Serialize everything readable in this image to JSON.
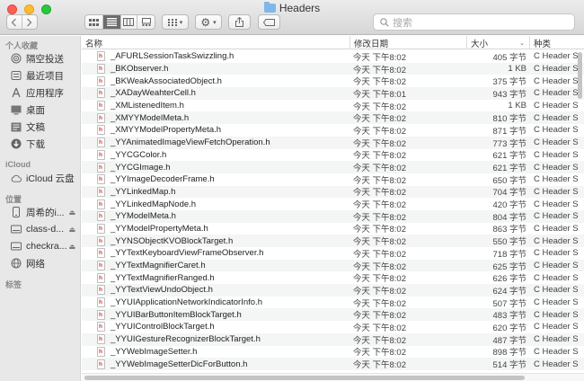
{
  "window": {
    "title": "Headers"
  },
  "toolbar": {
    "back_icon": "chevron-left-icon",
    "forward_icon": "chevron-right-icon",
    "view_icons": [
      "icon-view-icon",
      "list-view-icon",
      "column-view-icon",
      "gallery-view-icon"
    ],
    "group_icon": "group-grid-icon",
    "action_icon": "gear-icon",
    "share_icon": "share-icon",
    "tag_icon": "tag-icon",
    "search_placeholder": "搜索"
  },
  "sidebar": {
    "favorites_label": "个人收藏",
    "favorites": [
      {
        "label": "隔空投送",
        "icon": "airdrop-icon"
      },
      {
        "label": "最近项目",
        "icon": "recents-icon"
      },
      {
        "label": "应用程序",
        "icon": "applications-icon"
      },
      {
        "label": "桌面",
        "icon": "desktop-icon"
      },
      {
        "label": "文稿",
        "icon": "documents-icon"
      },
      {
        "label": "下载",
        "icon": "downloads-icon"
      }
    ],
    "icloud_label": "iCloud",
    "icloud": [
      {
        "label": "iCloud 云盘",
        "icon": "cloud-icon"
      }
    ],
    "locations_label": "位置",
    "locations": [
      {
        "label": "周希的i...",
        "icon": "disk-icon"
      },
      {
        "label": "class-d...",
        "icon": "disk-icon"
      },
      {
        "label": "checkra...",
        "icon": "disk-icon"
      },
      {
        "label": "网络",
        "icon": "network-icon"
      }
    ],
    "tags_label": "标签"
  },
  "columns": {
    "name": "名称",
    "date": "修改日期",
    "size": "大小",
    "kind": "种类"
  },
  "files": [
    {
      "name": "_AFURLSessionTaskSwizzling.h",
      "date": "今天 下午8:02",
      "size": "405 字节",
      "kind": "C Header S"
    },
    {
      "name": "_BKObserver.h",
      "date": "今天 下午8:02",
      "size": "1 KB",
      "kind": "C Header S"
    },
    {
      "name": "_BKWeakAssociatedObject.h",
      "date": "今天 下午8:02",
      "size": "375 字节",
      "kind": "C Header S"
    },
    {
      "name": "_XADayWeahterCell.h",
      "date": "今天 下午8:01",
      "size": "943 字节",
      "kind": "C Header S"
    },
    {
      "name": "_XMListenedItem.h",
      "date": "今天 下午8:02",
      "size": "1 KB",
      "kind": "C Header S"
    },
    {
      "name": "_XMYYModelMeta.h",
      "date": "今天 下午8:02",
      "size": "810 字节",
      "kind": "C Header S"
    },
    {
      "name": "_XMYYModelPropertyMeta.h",
      "date": "今天 下午8:02",
      "size": "871 字节",
      "kind": "C Header S"
    },
    {
      "name": "_YYAnimatedImageViewFetchOperation.h",
      "date": "今天 下午8:02",
      "size": "773 字节",
      "kind": "C Header S"
    },
    {
      "name": "_YYCGColor.h",
      "date": "今天 下午8:02",
      "size": "621 字节",
      "kind": "C Header S"
    },
    {
      "name": "_YYCGImage.h",
      "date": "今天 下午8:02",
      "size": "621 字节",
      "kind": "C Header S"
    },
    {
      "name": "_YYImageDecoderFrame.h",
      "date": "今天 下午8:02",
      "size": "650 字节",
      "kind": "C Header S"
    },
    {
      "name": "_YYLinkedMap.h",
      "date": "今天 下午8:02",
      "size": "704 字节",
      "kind": "C Header S"
    },
    {
      "name": "_YYLinkedMapNode.h",
      "date": "今天 下午8:02",
      "size": "420 字节",
      "kind": "C Header S"
    },
    {
      "name": "_YYModelMeta.h",
      "date": "今天 下午8:02",
      "size": "804 字节",
      "kind": "C Header S"
    },
    {
      "name": "_YYModelPropertyMeta.h",
      "date": "今天 下午8:02",
      "size": "863 字节",
      "kind": "C Header S"
    },
    {
      "name": "_YYNSObjectKVOBlockTarget.h",
      "date": "今天 下午8:02",
      "size": "550 字节",
      "kind": "C Header S"
    },
    {
      "name": "_YYTextKeyboardViewFrameObserver.h",
      "date": "今天 下午8:02",
      "size": "718 字节",
      "kind": "C Header S"
    },
    {
      "name": "_YYTextMagnifierCaret.h",
      "date": "今天 下午8:02",
      "size": "625 字节",
      "kind": "C Header S"
    },
    {
      "name": "_YYTextMagnifierRanged.h",
      "date": "今天 下午8:02",
      "size": "626 字节",
      "kind": "C Header S"
    },
    {
      "name": "_YYTextViewUndoObject.h",
      "date": "今天 下午8:02",
      "size": "624 字节",
      "kind": "C Header S"
    },
    {
      "name": "_YYUIApplicationNetworkIndicatorInfo.h",
      "date": "今天 下午8:02",
      "size": "507 字节",
      "kind": "C Header S"
    },
    {
      "name": "_YYUIBarButtonItemBlockTarget.h",
      "date": "今天 下午8:02",
      "size": "483 字节",
      "kind": "C Header S"
    },
    {
      "name": "_YYUIControlBlockTarget.h",
      "date": "今天 下午8:02",
      "size": "620 字节",
      "kind": "C Header S"
    },
    {
      "name": "_YYUIGestureRecognizerBlockTarget.h",
      "date": "今天 下午8:02",
      "size": "487 字节",
      "kind": "C Header S"
    },
    {
      "name": "_YYWebImageSetter.h",
      "date": "今天 下午8:02",
      "size": "898 字节",
      "kind": "C Header S"
    },
    {
      "name": "_YYWebImageSetterDicForButton.h",
      "date": "今天 下午8:02",
      "size": "514 字节",
      "kind": "C Header S"
    }
  ]
}
